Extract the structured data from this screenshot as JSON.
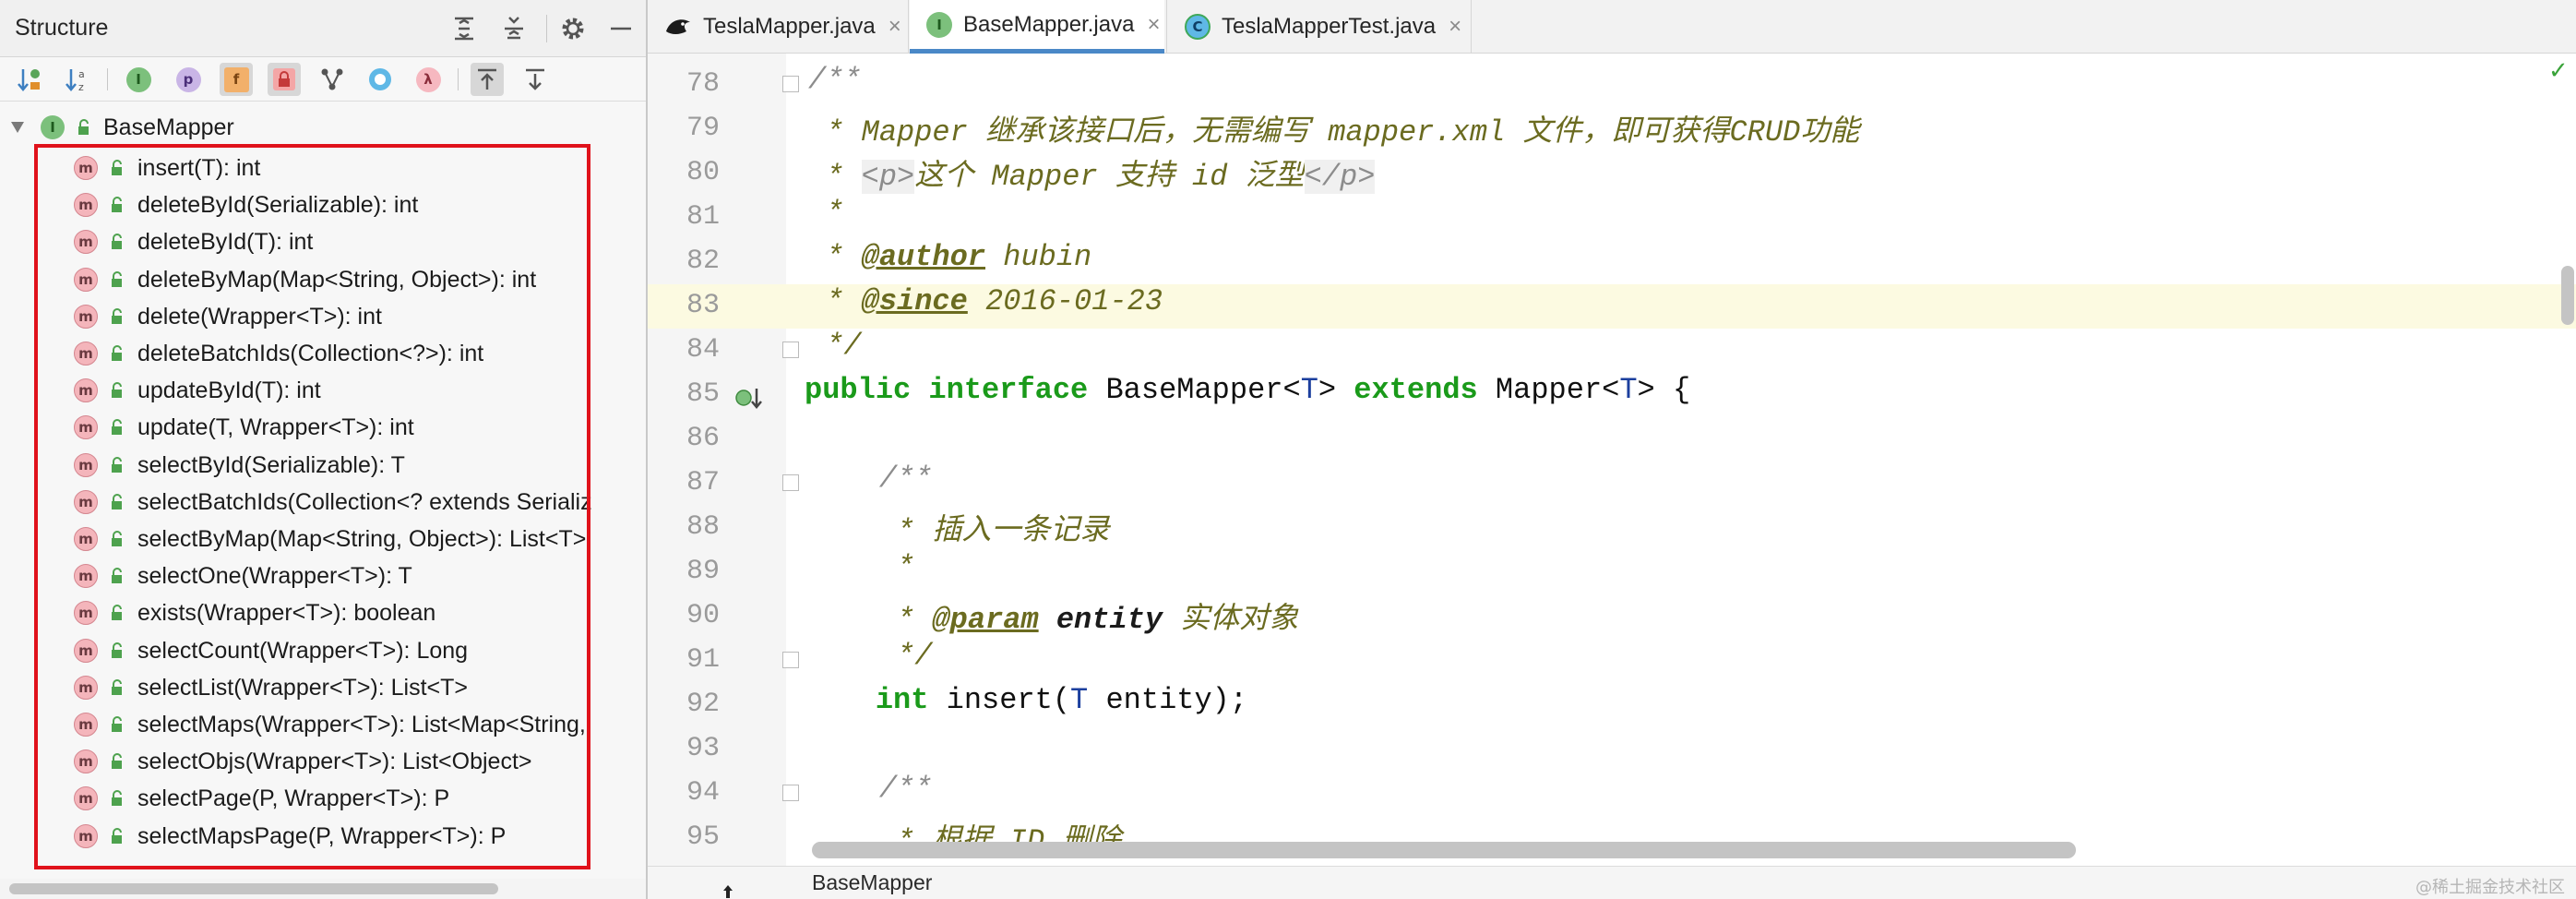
{
  "structure": {
    "title": "Structure",
    "root_label": "BaseMapper",
    "items": [
      {
        "label": "insert(T): int"
      },
      {
        "label": "deleteById(Serializable): int"
      },
      {
        "label": "deleteById(T): int"
      },
      {
        "label": "deleteByMap(Map<String, Object>): int"
      },
      {
        "label": "delete(Wrapper<T>): int"
      },
      {
        "label": "deleteBatchIds(Collection<?>): int"
      },
      {
        "label": "updateById(T): int"
      },
      {
        "label": "update(T, Wrapper<T>): int"
      },
      {
        "label": "selectById(Serializable): T"
      },
      {
        "label": "selectBatchIds(Collection<? extends Serializ"
      },
      {
        "label": "selectByMap(Map<String, Object>): List<T>"
      },
      {
        "label": "selectOne(Wrapper<T>): T"
      },
      {
        "label": "exists(Wrapper<T>): boolean"
      },
      {
        "label": "selectCount(Wrapper<T>): Long"
      },
      {
        "label": "selectList(Wrapper<T>): List<T>"
      },
      {
        "label": "selectMaps(Wrapper<T>): List<Map<String,"
      },
      {
        "label": "selectObjs(Wrapper<T>): List<Object>"
      },
      {
        "label": "selectPage(P, Wrapper<T>): P"
      },
      {
        "label": "selectMapsPage(P, Wrapper<T>): P"
      }
    ],
    "highlight_color": "#e0121b"
  },
  "toolbar_icons": {
    "interface_letter": "I",
    "property_letter": "p",
    "field_letter": "f",
    "lambda_letter": "λ",
    "method_letter": "m"
  },
  "tabs": [
    {
      "label": "TeslaMapper.java",
      "close": "×"
    },
    {
      "label": "BaseMapper.java",
      "close": "×",
      "icon_letter": "I"
    },
    {
      "label": "TeslaMapperTest.java",
      "close": "×",
      "icon_letter": "C"
    }
  ],
  "editor": {
    "line_numbers": [
      "78",
      "79",
      "80",
      "81",
      "82",
      "83",
      "84",
      "85",
      "86",
      "87",
      "88",
      "89",
      "90",
      "91",
      "92",
      "93",
      "94",
      "95"
    ],
    "current_line": "83",
    "code": {
      "l78": "/**",
      "l79": " * Mapper 继承该接口后，无需编写 mapper.xml 文件，即可获得CRUD功能",
      "l80_prefix": " * ",
      "l80_p_open": "<p>",
      "l80_text": "这个 Mapper 支持 id 泛型",
      "l80_p_close": "</p>",
      "l81": " *",
      "l82_prefix": " * ",
      "l82_tag": "@author",
      "l82_val": " hubin",
      "l83_prefix": " * ",
      "l83_tag": "@since",
      "l83_val": " 2016-01-23",
      "l84": " */",
      "l85_kw1": "public",
      "l85_kw2": "interface",
      "l85_name": " BaseMapper<",
      "l85_t1": "T",
      "l85_gt": "> ",
      "l85_kw3": "extends",
      "l85_parent": " Mapper<",
      "l85_t2": "T",
      "l85_end": "> {",
      "l87": "    /**",
      "l88": "     * 插入一条记录",
      "l89": "     *",
      "l90_prefix": "     * ",
      "l90_tag": "@param",
      "l90_param": " entity",
      "l90_desc": " 实体对象",
      "l91": "     */",
      "l92_kw": "int",
      "l92_mid": " insert(",
      "l92_t": "T",
      "l92_end": " entity);",
      "l94": "    /**",
      "l95": "     * 根据 ID 删除"
    },
    "check_mark": "✓"
  },
  "breadcrumb": "BaseMapper",
  "watermark": "@稀土掘金技术社区",
  "colors": {
    "keyword": "#1a9a1a",
    "doc_comment": "#6b6b20",
    "type_param": "#1c3f9e",
    "current_line_bg": "#fcfae1",
    "active_tab_underline": "#4a88c7"
  }
}
